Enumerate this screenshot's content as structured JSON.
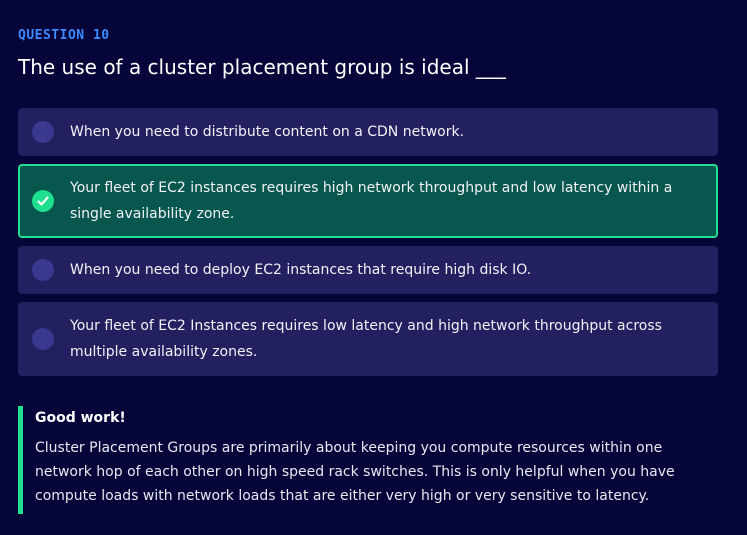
{
  "question": {
    "label": "QUESTION 10",
    "text": "The use of a cluster placement group is ideal ___"
  },
  "options": [
    {
      "text": "When you need to distribute content on a CDN network.",
      "selected": false
    },
    {
      "text": "Your fleet of EC2 instances requires high network throughput and low latency within a single availability zone.",
      "selected": true
    },
    {
      "text": "When you need to deploy EC2 instances that require high disk IO.",
      "selected": false
    },
    {
      "text": "Your fleet of EC2 Instances requires low latency and high network throughput across multiple availability zones.",
      "selected": false
    }
  ],
  "feedback": {
    "title": "Good work!",
    "text": "Cluster Placement Groups are primarily about keeping you compute resources within one network hop of each other on high speed rack switches. This is only helpful when you have compute loads with network loads that are either very high or very sensitive to latency."
  },
  "colors": {
    "background": "#06053a",
    "accent_label": "#3d8bff",
    "option_bg": "#22205f",
    "correct_bg": "#07574f",
    "correct_border": "#1ee08f"
  },
  "icons": {
    "correct": "checkmark-icon"
  }
}
